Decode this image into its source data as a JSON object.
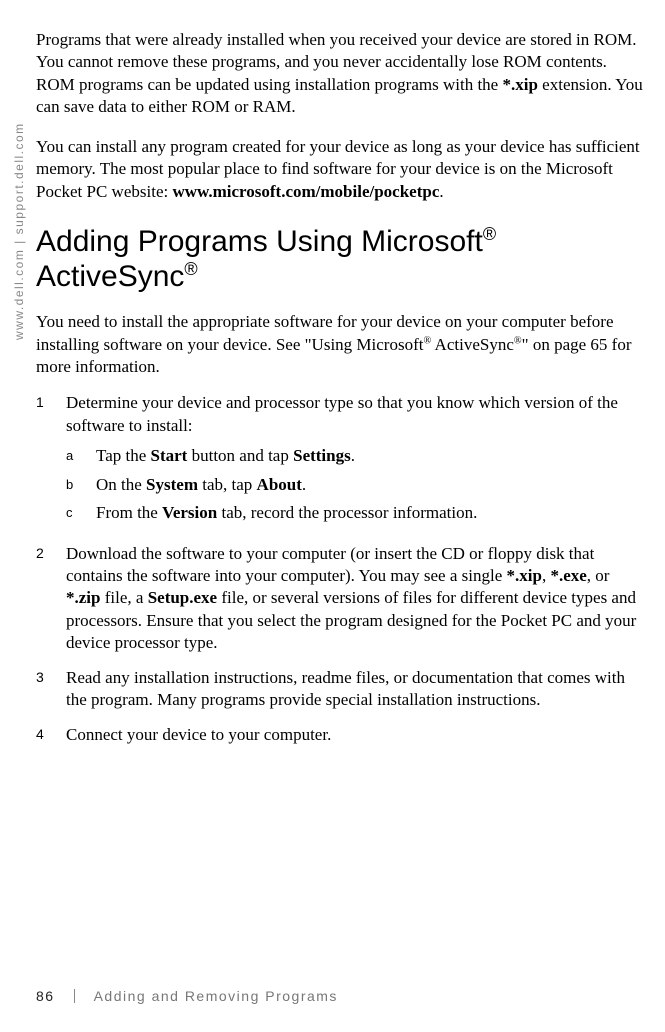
{
  "sidebar": "www.dell.com | support.dell.com",
  "paragraphs": {
    "p1_a": "Programs that were already installed when you received your device are stored in ROM. You cannot remove these programs, and you never accidentally lose ROM contents. ROM programs can be updated using installation programs with the ",
    "p1_b": "*.xip",
    "p1_c": " extension. You can save data to either ROM or RAM.",
    "p2_a": "You can install any program created for your device as long as your device has sufficient memory. The most popular place to find software for your device is on the Microsoft Pocket PC website: ",
    "p2_b": "www.microsoft.com/mobile/pocketpc",
    "p2_c": "."
  },
  "heading": {
    "part1": "Adding Programs Using Microsoft",
    "sup1": "®",
    "part2": " ActiveSync",
    "sup2": "®"
  },
  "intro": {
    "a": "You need to install the appropriate software for your device on your computer before installing software on your device. See \"Using Microsoft",
    "sup1": "®",
    "b": " ActiveSync",
    "sup2": "®",
    "c": "\" on page 65 for more information."
  },
  "steps": {
    "s1": {
      "num": "1",
      "text": "Determine your device and processor type so that you know which version of the software to install:",
      "sub": {
        "a": {
          "letter": "a",
          "t1": "Tap the ",
          "b1": "Start",
          "t2": " button and tap ",
          "b2": "Settings",
          "t3": "."
        },
        "b": {
          "letter": "b",
          "t1": "On the ",
          "b1": "System",
          "t2": " tab, tap ",
          "b2": "About",
          "t3": "."
        },
        "c": {
          "letter": "c",
          "t1": "From the ",
          "b1": "Version",
          "t2": " tab, record the processor information."
        }
      }
    },
    "s2": {
      "num": "2",
      "t1": "Download the software to your computer (or insert the CD or floppy disk that contains the software into your computer). You may see a single ",
      "b1": "*.xip",
      "t2": ", ",
      "b2": "*.exe",
      "t3": ", or ",
      "b3": "*.zip",
      "t4": " file, a ",
      "b4": "Setup.exe",
      "t5": " file, or several versions of files for different device types and processors. Ensure that you select the program designed for the Pocket PC and your device processor type."
    },
    "s3": {
      "num": "3",
      "text": "Read any installation instructions, readme files, or documentation that comes with the program. Many programs provide special installation instructions."
    },
    "s4": {
      "num": "4",
      "text": "Connect your device to your computer."
    }
  },
  "footer": {
    "page": "86",
    "section": "Adding and Removing Programs"
  }
}
